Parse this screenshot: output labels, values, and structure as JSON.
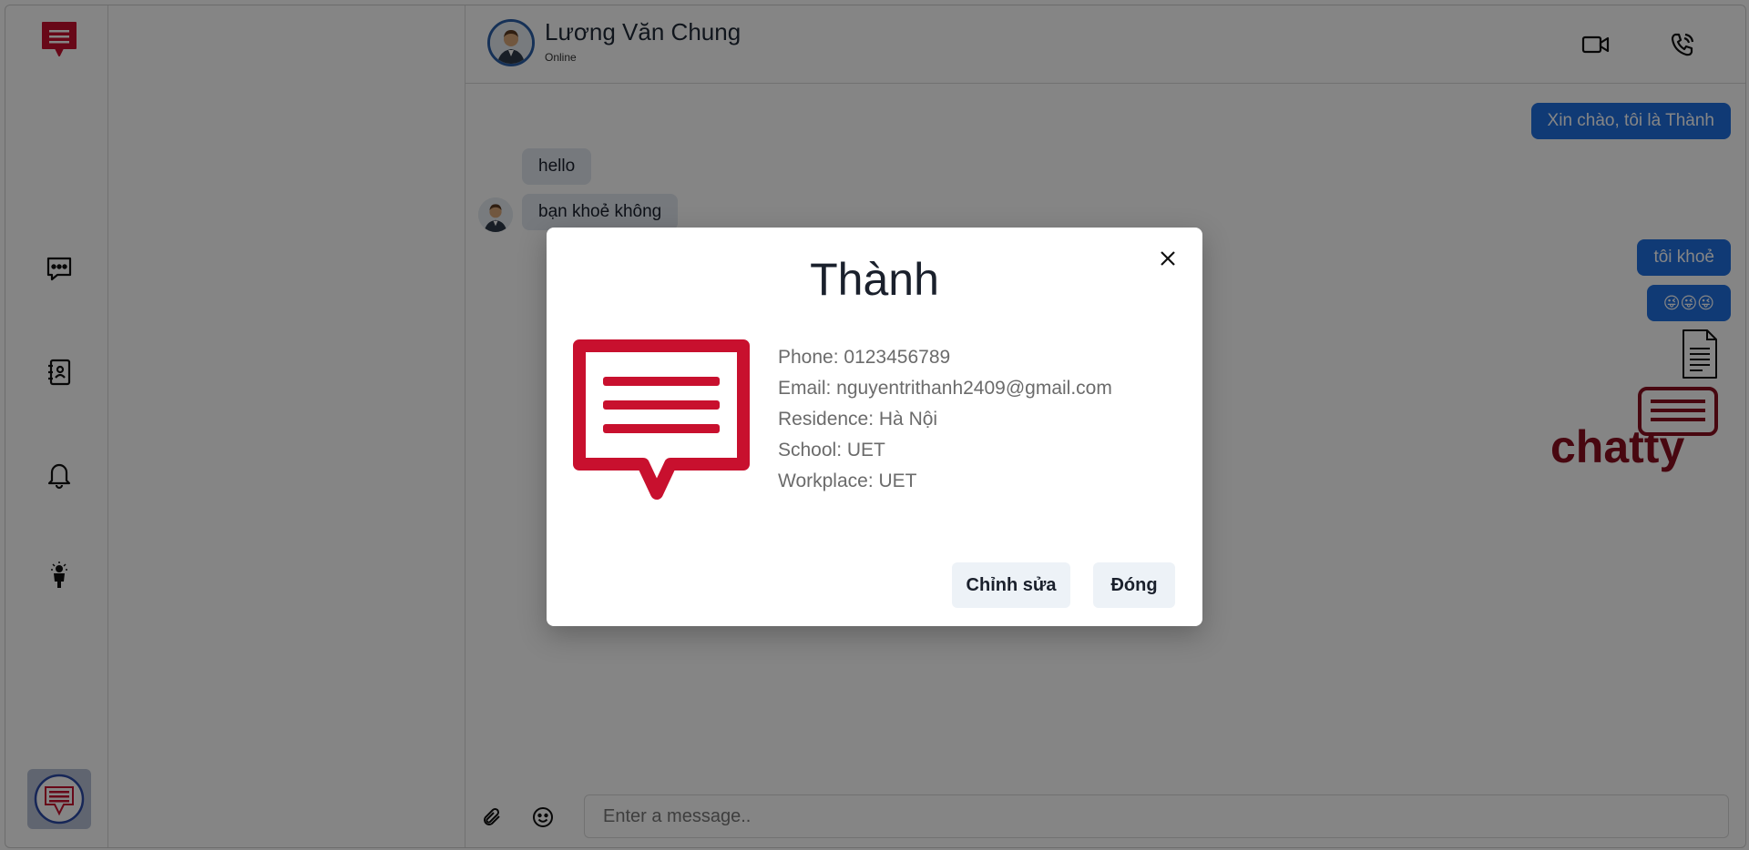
{
  "header": {
    "contact_name": "Lương Văn Chung",
    "contact_status": "Online"
  },
  "messages": [
    {
      "side": "out",
      "text": "Xin chào, tôi là Thành"
    },
    {
      "side": "in",
      "text": "hello"
    },
    {
      "side": "in",
      "text": "bạn khoẻ không"
    },
    {
      "side": "out",
      "text": "tôi khoẻ"
    },
    {
      "side": "out",
      "text": "😜😜😜"
    }
  ],
  "attachment": {
    "logo_text": "chatty",
    "icon": "document-icon"
  },
  "composer": {
    "placeholder": "Enter a message.."
  },
  "profile_modal": {
    "name": "Thành",
    "phone": "Phone: 0123456789",
    "email": "Email: nguyentrithanh2409@gmail.com",
    "residence": "Residence: Hà Nội",
    "school": "School: UET",
    "workplace": "Workplace: UET",
    "edit_label": "Chỉnh sửa",
    "close_label": "Đóng"
  },
  "colors": {
    "brand": "#c8102e",
    "outgoing_bubble": "#1f6fe0",
    "incoming_bubble": "#e2e8f0"
  },
  "icons": [
    "chat-bubble-icon",
    "contacts-icon",
    "bell-icon",
    "person-idea-icon",
    "video-camera-icon",
    "phone-call-icon",
    "paperclip-icon",
    "smiley-icon",
    "close-icon"
  ]
}
